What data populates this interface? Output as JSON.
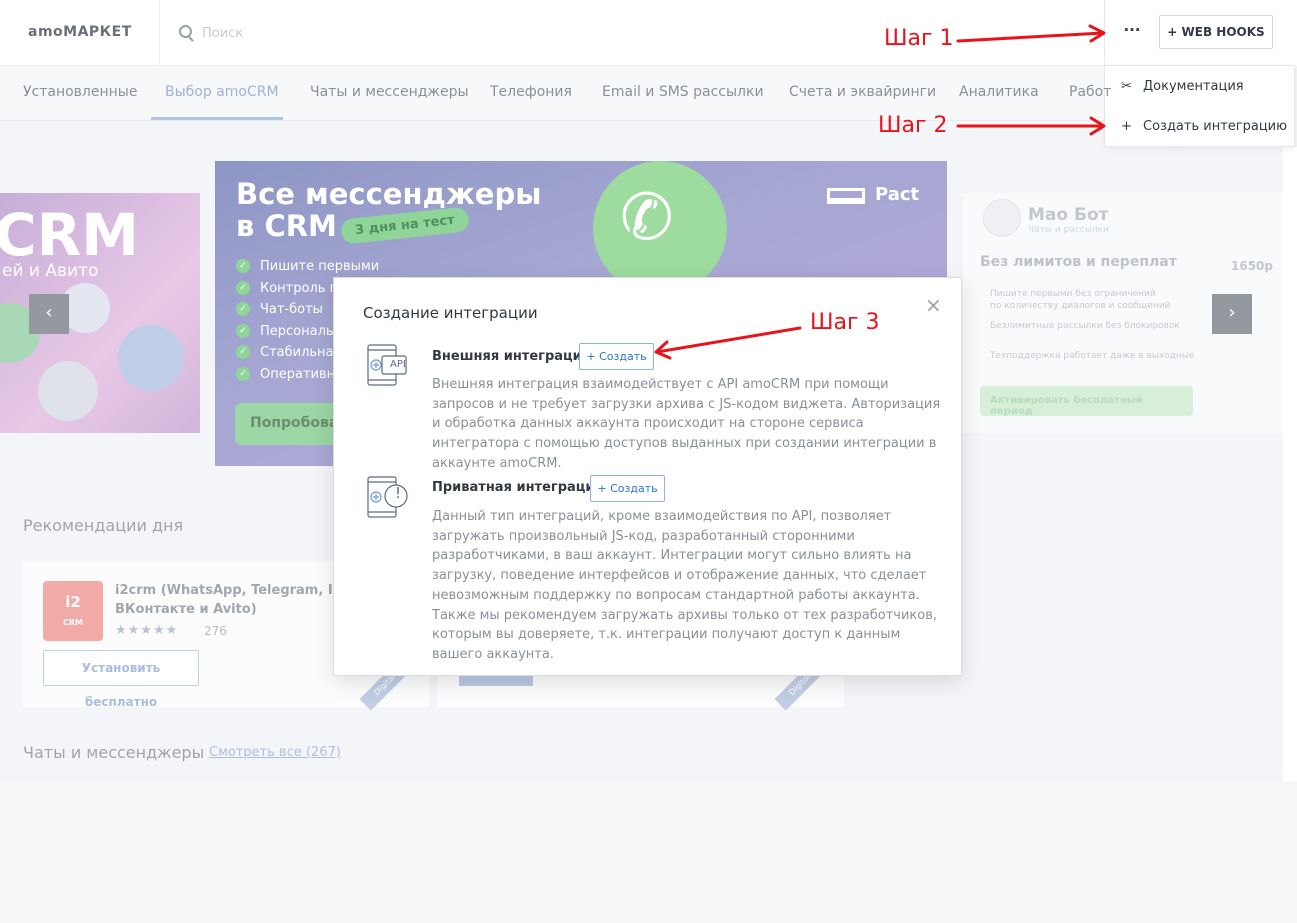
{
  "header": {
    "logo": "amoМАРКЕТ",
    "search_placeholder": "Поиск",
    "more_label": "···",
    "webhooks_label": "+ WEB HOOKS"
  },
  "dropdown": {
    "items": [
      {
        "icon": "tools-icon",
        "glyph": "✂",
        "label": "Документация"
      },
      {
        "icon": "plus-icon",
        "glyph": "+",
        "label": "Создать интеграцию"
      }
    ]
  },
  "tabs": [
    {
      "label": "Установленные",
      "active": false
    },
    {
      "label": "Выбор amoCRM",
      "active": true
    },
    {
      "label": "Чаты и мессенджеры",
      "active": false
    },
    {
      "label": "Телефония",
      "active": false
    },
    {
      "label": "Email и SMS рассылки",
      "active": false
    },
    {
      "label": "Счета и эквайринги",
      "active": false
    },
    {
      "label": "Аналитика",
      "active": false
    },
    {
      "label": "Работ",
      "active": false
    }
  ],
  "carousel": {
    "left": {
      "title": "CRM",
      "subtitle": "ей и Авито"
    },
    "main": {
      "title_line1": "Все мессенджеры",
      "title_line2": "в CRM",
      "badge": "3 дня на тест",
      "bullets": [
        "Пишите первыми",
        "Контроль п",
        "Чат-боты",
        "Персональ",
        "Стабильна",
        "Оперативн"
      ],
      "button": "Попробова",
      "brand": "Pact"
    },
    "right": {
      "title": "Мао Бот",
      "subtitle": "Чаты и рассылки",
      "headline": "Без лимитов и переплат",
      "lines": [
        "Пишите первыми без ограничений",
        "по количеству диалогов и сообщений",
        "Безлимитные рассылки без блокировок",
        "Техподдержка работает даже в выходные"
      ],
      "price": "1650р",
      "button": "Активировать бесплатный период"
    },
    "prev_label": "‹",
    "next_label": "›"
  },
  "recommendations": {
    "title": "Рекомендации дня",
    "cards": [
      {
        "logo": "i2",
        "logo_sub": "CRM",
        "title": "i2crm (WhatsApp, Telegram, Instag ВКонтакте и Avito)",
        "stars": "★★★★★",
        "count": "276",
        "install": "Установить бесплатно",
        "ribbon": "Digital"
      },
      {
        "ribbon": "Digital"
      }
    ]
  },
  "chats_section": {
    "title": "Чаты и мессенджеры",
    "link": "Смотреть все (267)"
  },
  "modal": {
    "title": "Создание интеграции",
    "close": "×",
    "options": [
      {
        "icon_text": "API",
        "title": "Внешняя интеграция",
        "create": "+ Создать",
        "description": "Внешняя интеграция взаимодействует с API amoCRM при помощи запросов и не требует загрузки архива с JS-кодом виджета. Авторизация и обработка данных аккаунта происходит на стороне сервиса интегратора с помощью доступов выданных при создании интеграции в аккаунте amoCRM."
      },
      {
        "icon_text": "!",
        "title": "Приватная интеграция",
        "create": "+ Создать",
        "description": "Данный тип интеграций, кроме взаимодействия по API, позволяет загружать произвольный JS-код, разработанный сторонними разработчиками, в ваш аккаунт. Интеграции могут сильно влиять на загрузку, поведение интерфейсов и отображение данных, что сделает невозможным поддержку по вопросам стандартной работы аккаунта. Также мы рекомендуем загружать архивы только от тех разработчиков, которым вы доверяете, т.к. интеграции получают доступ к данным вашего аккаунта."
      }
    ]
  },
  "annotations": {
    "step1": "Шаг 1",
    "step2": "Шаг 2",
    "step3": "Шаг 3",
    "color": "#e8141c"
  }
}
